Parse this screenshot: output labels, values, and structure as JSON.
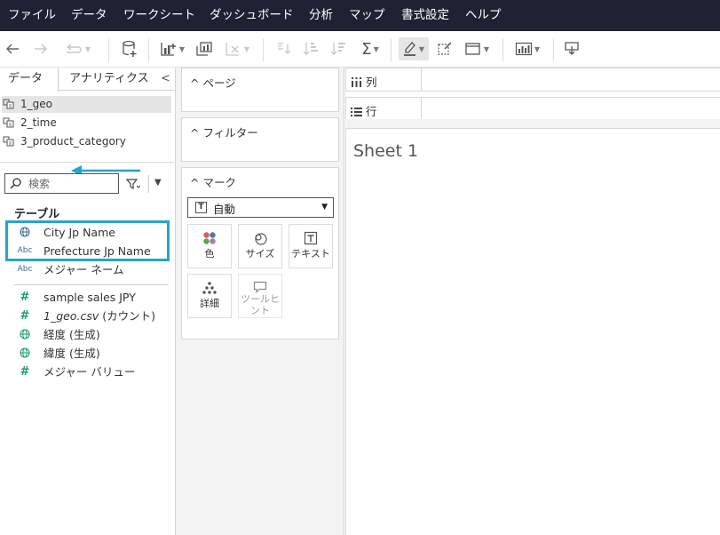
{
  "menubar": {
    "items": [
      "ファイル",
      "データ",
      "ワークシート",
      "ダッシュボード",
      "分析",
      "マップ",
      "書式設定",
      "ヘルプ"
    ]
  },
  "toolbar": {
    "icons": [
      "back-icon",
      "forward-icon",
      "redo-icon",
      "new-datasource-icon",
      "new-worksheet-icon",
      "duplicate-icon",
      "clear-sheet-icon",
      "swap-icon",
      "sort-asc-icon",
      "sort-desc-icon",
      "totals-icon",
      "highlight-icon",
      "annotate-icon",
      "fit-icon",
      "show-me-icon",
      "presentation-icon"
    ]
  },
  "data_pane": {
    "tabs": {
      "data": "データ",
      "analytics": "アナリティクス",
      "collapse": "<"
    },
    "datasources": [
      "1_geo",
      "2_time",
      "3_product_category"
    ],
    "selected_datasource": "1_geo",
    "search": {
      "placeholder": "検索"
    },
    "section_heading": "テーブル",
    "dimension_fields": [
      {
        "icon": "globe-icon",
        "label": "City Jp Name"
      },
      {
        "icon": "abc-icon",
        "label": "Prefecture Jp Name"
      },
      {
        "icon": "abc-icon",
        "label": "メジャー ネーム"
      }
    ],
    "measure_fields": [
      {
        "icon": "hash-icon",
        "label": "sample sales JPY"
      },
      {
        "icon": "hash-icon",
        "label": "1_geo.csv",
        "suffix": " (カウント)"
      },
      {
        "icon": "globe-icon",
        "label": "経度 (生成)"
      },
      {
        "icon": "globe-icon",
        "label": "緯度 (生成)"
      },
      {
        "icon": "hash-icon",
        "label": "メジャー バリュー"
      }
    ],
    "abc_glyph": "Abc",
    "hash_glyph": "#"
  },
  "shelves": {
    "pages": "ページ",
    "filters": "フィルター",
    "marks": "マーク",
    "mark_type": "自動",
    "mark_buttons": [
      {
        "label": "色",
        "icon": "color-icon"
      },
      {
        "label": "サイズ",
        "icon": "size-icon"
      },
      {
        "label": "テキスト",
        "icon": "text-icon"
      },
      {
        "label": "詳細",
        "icon": "detail-icon"
      },
      {
        "label": "ツールヒ\nント",
        "icon": "tooltip-icon"
      }
    ],
    "collapse_glyph": "^"
  },
  "rows_columns": {
    "columns": "列",
    "rows": "行"
  },
  "view": {
    "sheet_title": "Sheet 1"
  },
  "colors": {
    "menubar_bg": "#1f2233",
    "highlight": "#26a6c9",
    "measure_green": "#1a9e68",
    "dimension_blue": "#3e6e96"
  }
}
